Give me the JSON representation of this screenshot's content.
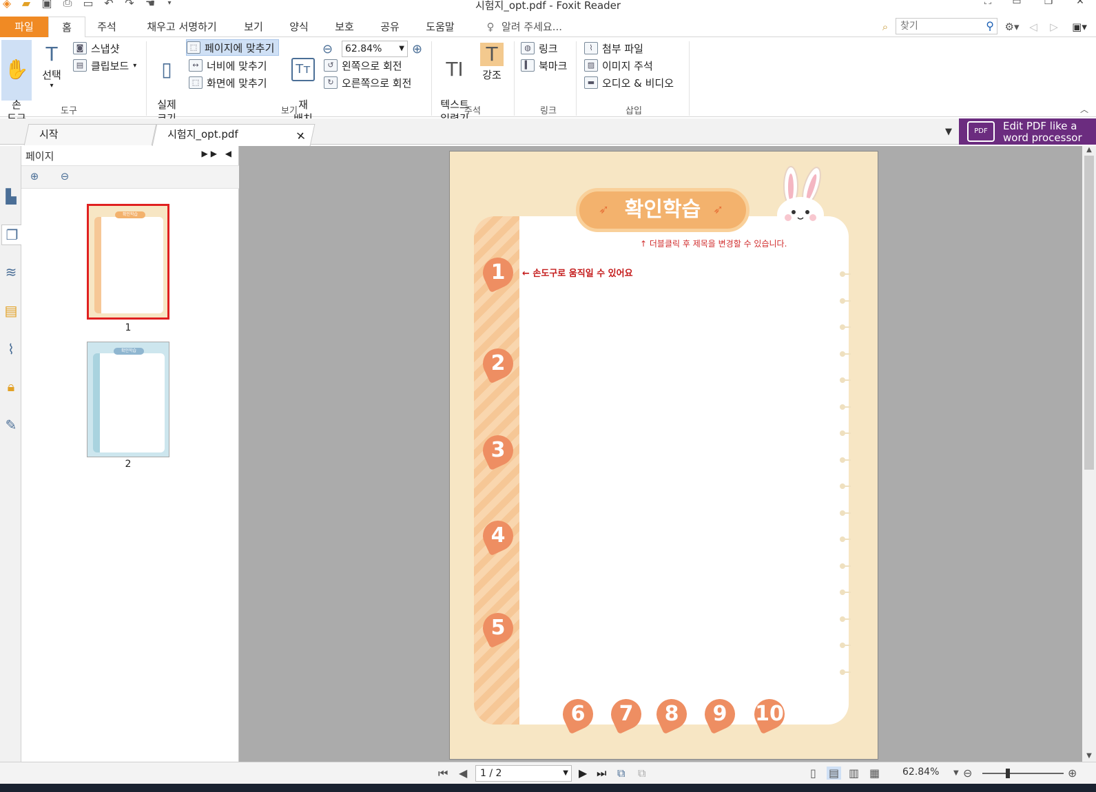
{
  "app": {
    "title": "시험지_opt.pdf - Foxit Reader"
  },
  "ribbon_tabs": {
    "file": "파일",
    "items": [
      "홈",
      "주석",
      "채우고 서명하기",
      "보기",
      "양식",
      "보호",
      "공유",
      "도움말"
    ],
    "tell_me": "알려 주세요...",
    "search_placeholder": "찾기"
  },
  "ribbon": {
    "hand_tool": "손\n도구",
    "select": "선택",
    "snapshot": "스냅샷",
    "clipboard": "클립보드",
    "actual_size": "실제\n크기",
    "fit_page": "페이지에 맞추기",
    "fit_width": "너비에 맞추기",
    "fit_visible": "화면에 맞추기",
    "reflow": "재\n배치",
    "zoom_value": "62.84%",
    "rotate_left": "왼쪽으로 회전",
    "rotate_right": "오른쪽으로 회전",
    "typewriter": "텍스트\n입력기",
    "highlight": "강조",
    "link": "링크",
    "bookmark": "북마크",
    "attach_file": "첨부 파일",
    "image_annotation": "이미지 주석",
    "audio_video": "오디오 & 비디오",
    "groups": {
      "tools": "도구",
      "view": "보기",
      "comment": "주석",
      "links": "링크",
      "insert": "삽입"
    }
  },
  "doc_tabs": {
    "start": "시작",
    "current": "시험지_opt.pdf",
    "ad_line1": "Edit PDF like a",
    "ad_line2": "word processor"
  },
  "pages_panel": {
    "title": "페이지",
    "thumbnails": [
      {
        "label": "1",
        "title": "확인학습"
      },
      {
        "label": "2",
        "title": "확인학습"
      }
    ]
  },
  "page_content": {
    "title": "확인학습",
    "red_note": "↑ 더블클릭 후 제목을 변경할 수 있습니다.",
    "move_note": "← 손도구로 움직일 수 있어요",
    "left_numbers": [
      "1",
      "2",
      "3",
      "4",
      "5"
    ],
    "bottom_numbers": [
      "6",
      "7",
      "8",
      "9",
      "10"
    ]
  },
  "status": {
    "page_indicator": "1 / 2",
    "zoom": "62.84%"
  },
  "colors": {
    "file_tab": "#f08a24",
    "page_bg": "#f7e6c4",
    "accent_orange": "#f3b26d",
    "carrot": "#ee8e62",
    "ad_purple": "#6b2c7f",
    "thumb2_blue": "#a9d3df"
  }
}
